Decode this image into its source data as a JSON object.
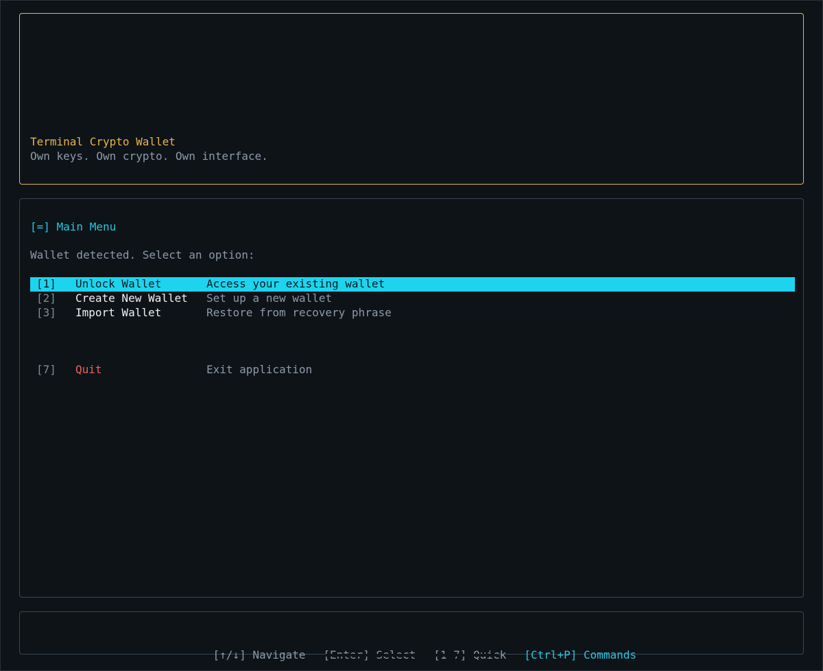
{
  "header": {
    "title": "Terminal Crypto Wallet",
    "tagline": "Own keys. Own crypto. Own interface."
  },
  "menu": {
    "title": "[=] Main Menu",
    "prompt": "Wallet detected. Select an option:",
    "items": [
      {
        "key": "[1]",
        "label": "Unlock Wallet",
        "description": "Access your existing wallet",
        "selected": true
      },
      {
        "key": "[2]",
        "label": "Create New Wallet",
        "description": "Set up a new wallet",
        "selected": false
      },
      {
        "key": "[3]",
        "label": "Import Wallet",
        "description": "Restore from recovery phrase",
        "selected": false
      },
      {
        "key": "[7]",
        "label": "Quit",
        "description": "Exit application",
        "selected": false
      }
    ]
  },
  "footer": {
    "hints": [
      {
        "text": "[↑/↓] Navigate"
      },
      {
        "text": "[Enter] Select"
      },
      {
        "text": "[1-7] Quick"
      },
      {
        "text": "[Ctrl+P] Commands"
      }
    ]
  },
  "colors": {
    "background": "#0e1317",
    "accent_cyan": "#1dd4ef",
    "accent_amber": "#e9b24c",
    "danger": "#f0605a"
  }
}
